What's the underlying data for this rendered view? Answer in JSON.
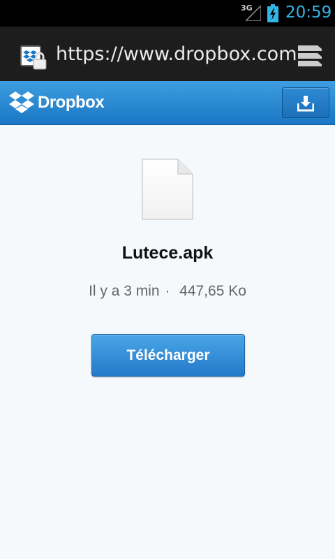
{
  "status_bar": {
    "network": "3G",
    "time": "20:59",
    "accent_color": "#33b5e5"
  },
  "browser": {
    "url": "https://www.dropbox.com",
    "site_icon": "dropbox-lock-icon",
    "tabs_icon": "tabs-icon"
  },
  "header": {
    "brand": "Dropbox",
    "logo_icon": "dropbox-logo-icon",
    "download_icon": "download-icon",
    "color": "#2a87d3"
  },
  "file": {
    "name": "Lutece.apk",
    "age": "Il y a 3 min",
    "separator": "·",
    "size": "447,65 Ko",
    "icon": "file-icon"
  },
  "actions": {
    "download_label": "Télécharger"
  }
}
